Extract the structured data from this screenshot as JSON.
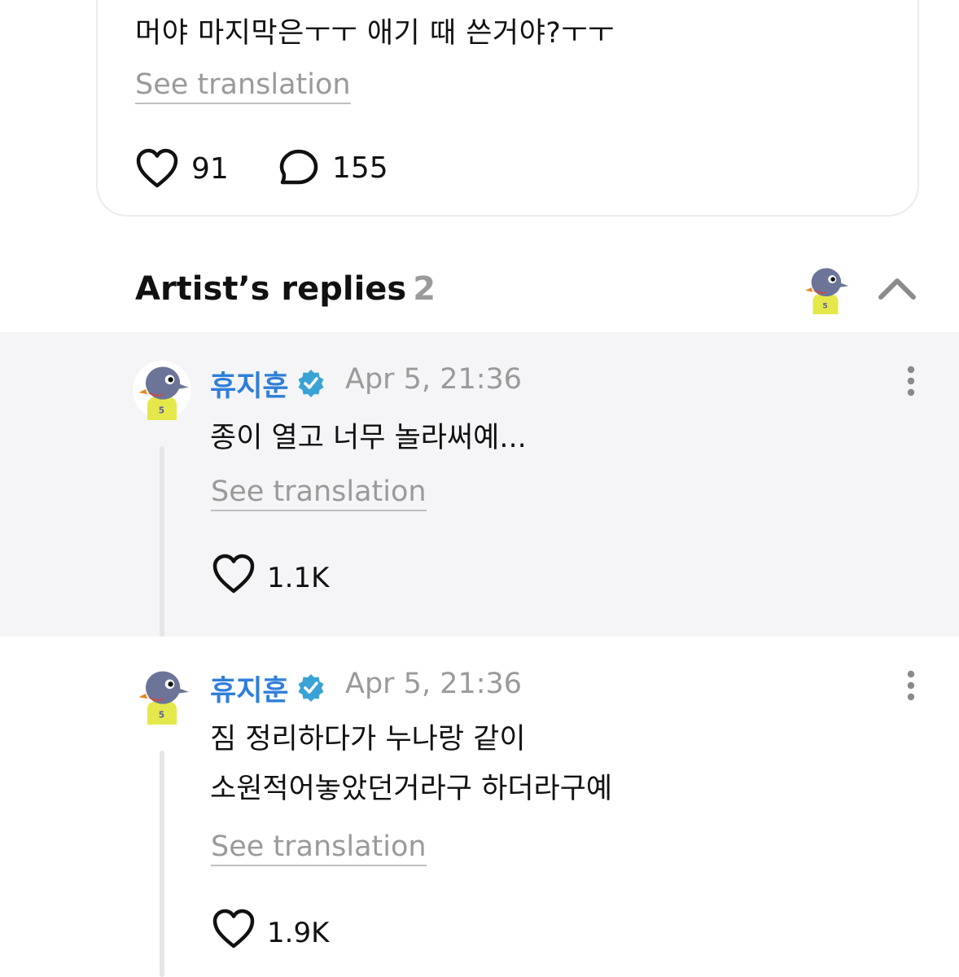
{
  "post": {
    "text": "머야 마지막은ㅜㅜ 애기 때 쓴거야?ㅜㅜ",
    "see_translation": "See translation",
    "likes": "91",
    "comments": "155",
    "icons": {
      "like": "heart-icon",
      "comment": "comment-bubble-icon"
    }
  },
  "artist_replies": {
    "title": "Artist’s replies",
    "count": "2",
    "icons": {
      "avatar": "penguin-avatar-icon",
      "collapse": "chevron-up-icon"
    }
  },
  "replies": [
    {
      "author": "휴지훈",
      "time": "Apr 5, 21:36",
      "text": "종이 열고 너무 놀라써예...",
      "see_translation": "See translation",
      "likes": "1.1K"
    },
    {
      "author": "휴지훈",
      "time": "Apr 5, 21:36",
      "text": "짐 정리하다가 누나랑 같이\n소원적어놓았던거라구 하더라구예",
      "text_line1": "짐 정리하다가 누나랑 같이",
      "text_line2": "소원적어놓았던거라구 하더라구예",
      "see_translation": "See translation",
      "likes": "1.9K"
    }
  ],
  "colors": {
    "verified_badge": "#3aa3d6",
    "author_name": "#2f7fd9",
    "highlight_background": "#f5f5f7",
    "muted_text": "#9a9a9a"
  }
}
